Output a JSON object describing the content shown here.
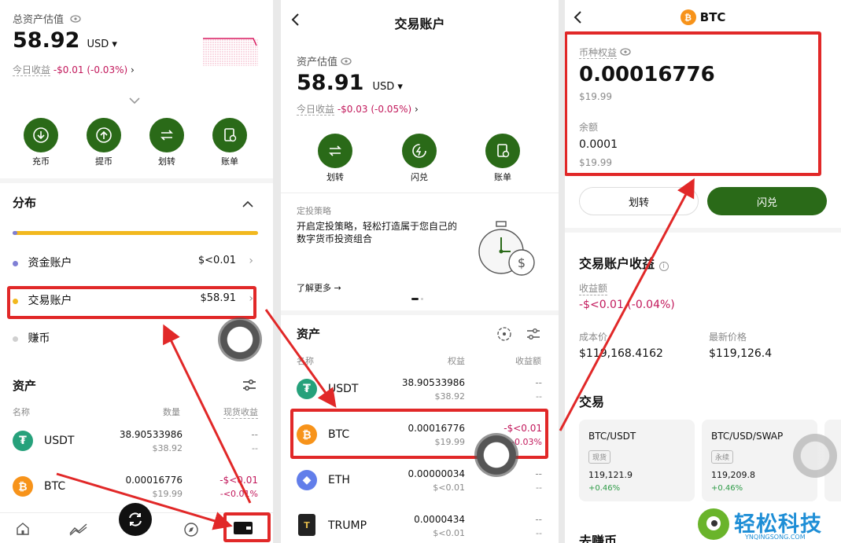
{
  "left": {
    "title": "总资产估值",
    "amount": "58.92",
    "currency": "USD",
    "today_label": "今日收益",
    "today_value": "-$0.01 (-0.03%)",
    "actions": [
      {
        "label": "充币",
        "icon": "deposit-icon"
      },
      {
        "label": "提币",
        "icon": "withdraw-icon"
      },
      {
        "label": "划转",
        "icon": "transfer-icon"
      },
      {
        "label": "账单",
        "icon": "bill-icon"
      }
    ],
    "distribution_title": "分布",
    "accounts": [
      {
        "name": "资金账户",
        "value": "$<0.01",
        "color": "#7f7fd5"
      },
      {
        "name": "交易账户",
        "value": "$58.91",
        "color": "#f2b81e"
      },
      {
        "name": "赚币",
        "value": "",
        "color": "#d0d0d0"
      }
    ],
    "assets_title": "资产",
    "col_name": "名称",
    "col_qty": "数量",
    "col_pnl": "现货收益",
    "assets": [
      {
        "name": "USDT",
        "qty": "38.90533986",
        "usd": "$38.92",
        "pnl": "--",
        "pnl2": "--"
      },
      {
        "name": "BTC",
        "qty": "0.00016776",
        "usd": "$19.99",
        "pnl": "-$<0.01",
        "pnl2": "-<0.01%"
      }
    ]
  },
  "middle": {
    "title": "交易账户",
    "est_label": "资产估值",
    "amount": "58.91",
    "currency": "USD",
    "today_label": "今日收益",
    "today_value": "-$0.03 (-0.05%)",
    "actions": [
      {
        "label": "划转",
        "icon": "transfer-icon"
      },
      {
        "label": "闪兑",
        "icon": "flash-swap-icon"
      },
      {
        "label": "账单",
        "icon": "bill-icon"
      }
    ],
    "banner_tag": "定投策略",
    "banner_text": "开启定投策略，轻松打造属于您自己的数字货币投资组合",
    "banner_link": "了解更多 →",
    "assets_title": "资产",
    "col_name": "名称",
    "col_equity": "权益",
    "col_pnl": "收益额",
    "assets": [
      {
        "name": "USDT",
        "qty": "38.90533986",
        "usd": "$38.92",
        "pnl": "--",
        "pnl2": "--"
      },
      {
        "name": "BTC",
        "qty": "0.00016776",
        "usd": "$19.99",
        "pnl": "-$<0.01",
        "pnl2": "-0.03%"
      },
      {
        "name": "ETH",
        "qty": "0.00000034",
        "usd": "$<0.01",
        "pnl": "--",
        "pnl2": "--"
      },
      {
        "name": "TRUMP",
        "qty": "0.0000434",
        "usd": "$<0.01",
        "pnl": "--",
        "pnl2": "--"
      }
    ]
  },
  "right": {
    "title": "BTC",
    "equity_label": "币种权益",
    "equity_value": "0.00016776",
    "equity_usd": "$19.99",
    "balance_label": "余额",
    "balance_value": "0.0001",
    "balance_usd": "$19.99",
    "btn_transfer": "划转",
    "btn_swap": "闪兑",
    "section_title": "交易账户收益",
    "pnl_label": "收益额",
    "pnl_value": "-$<0.01 (-0.04%)",
    "cost_label": "成本价",
    "cost_value": "$119,168.4162",
    "last_label": "最新价格",
    "last_value": "$119,126.4",
    "trade_title": "交易",
    "pairs": [
      {
        "name": "BTC/USDT",
        "tag": "现货",
        "price": "119,121.9",
        "change": "+0.46%"
      },
      {
        "name": "BTC/USD/SWAP",
        "tag": "永续",
        "price": "119,209.8",
        "change": "+0.46%"
      }
    ],
    "next_title": "去赚币"
  },
  "watermark": {
    "text": "轻松科技",
    "sub": "YNQINGSONG.COM"
  }
}
